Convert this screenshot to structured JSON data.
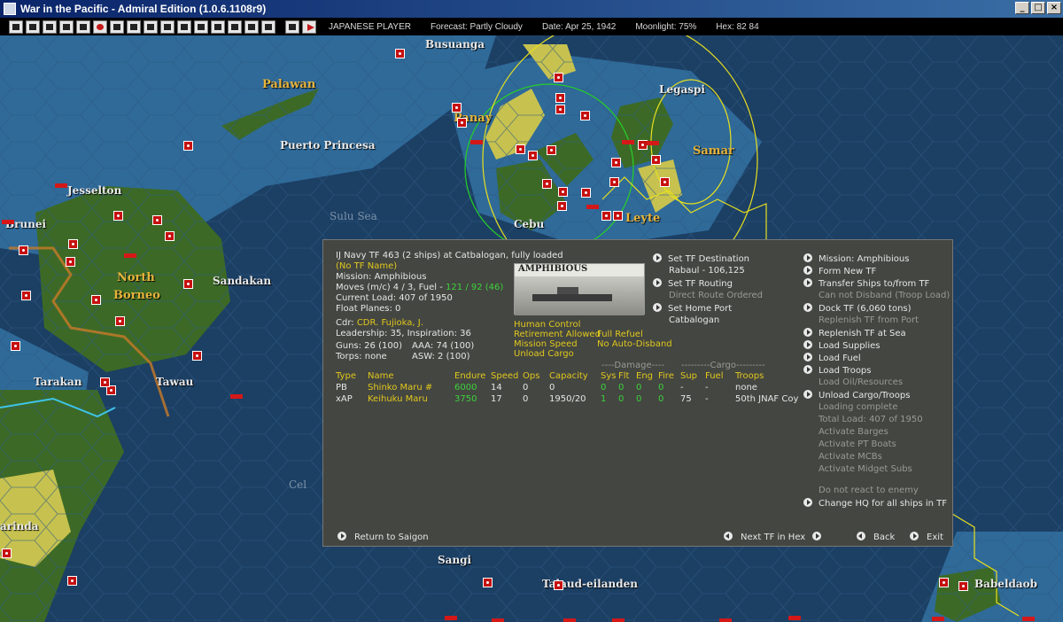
{
  "window": {
    "title": "War in the Pacific - Admiral Edition (1.0.6.1108r9)"
  },
  "toolbar": {
    "tool_icons": [
      "report-icon",
      "list-icon",
      "ships-icon",
      "aircraft-icon",
      "intel-icon",
      "rising-sun-icon",
      "squad-icon",
      "plane-icon",
      "flag-icon",
      "units-icon",
      "air-group-icon",
      "task-force-icon",
      "base-icon",
      "production-icon",
      "op-report-icon",
      "combat-report-icon",
      "save-icon",
      "end-turn-icon"
    ]
  },
  "status": {
    "player": "JAPANESE PLAYER",
    "forecast": "Forecast: Partly Cloudy",
    "date": "Date: Apr 25, 1942",
    "moonlight": "Moonlight: 75%",
    "hex": "Hex: 82 84"
  },
  "map": {
    "labels": [
      "Busuanga",
      "Palawan",
      "Panay",
      "Legaspi",
      "Samar",
      "Puerto Princesa",
      "Jesselton",
      "Brunei",
      "Sulu Sea",
      "Cebu",
      "Leyte",
      "North",
      "Borneo",
      "Sandakan",
      "Tarakan",
      "Tawau",
      "Sangi",
      "Talaud-eilanden",
      "Babeldaob",
      "arinda",
      "Cel"
    ]
  },
  "tf": {
    "header": "IJ Navy TF 463 (2 ships) at Catbalogan, fully loaded",
    "name": "(No TF Name)",
    "mission": "Mission: Amphibious",
    "moves_prefix": "Moves (m/c) 4 / 3, Fuel - ",
    "moves_fuel": "121 / 92 (46)",
    "load": "Current Load:  407 of 1950",
    "float": "Float Planes: 0",
    "cdr_label": "Cdr:",
    "cdr": "CDR. Fujioka, J.",
    "leadership": "Leadership: 35, Inspiration: 36",
    "guns": "Guns: 26 (100)",
    "aaa": "AAA: 74 (100)",
    "torps": "Torps: none",
    "asw": "ASW: 2 (100)",
    "photo_label": "AMPHIBIOUS",
    "flags_left": [
      "Human Control",
      "Retirement Allowed",
      "Mission Speed",
      "Unload Cargo"
    ],
    "flags_right": [
      "Full Refuel",
      "No Auto-Disband"
    ]
  },
  "table": {
    "headers": {
      "type": "Type",
      "name": "Name",
      "endure": "Endure",
      "speed": "Speed",
      "ops": "Ops",
      "capacity": "Capacity",
      "damage_group": "----Damage----",
      "sys": "Sys",
      "flt": "Flt",
      "eng": "Eng",
      "fire": "Fire",
      "cargo_group": "---------Cargo---------",
      "sup": "Sup",
      "fuel": "Fuel",
      "troops": "Troops"
    },
    "rows": [
      {
        "type": "PB",
        "name": "Shinko Maru #",
        "endure": "6000",
        "speed": "14",
        "ops": "0",
        "capacity": "0",
        "sys": "0",
        "flt": "0",
        "eng": "0",
        "fire": "0",
        "sup": "-",
        "fuel": "-",
        "troops": "none"
      },
      {
        "type": "xAP",
        "name": "Keihuku Maru",
        "endure": "3750",
        "speed": "17",
        "ops": "0",
        "capacity": "1950/20",
        "sys": "1",
        "flt": "0",
        "eng": "0",
        "fire": "0",
        "sup": "75",
        "fuel": "-",
        "troops": "50th JNAF Coy"
      }
    ]
  },
  "nav": {
    "set_dest": "Set TF Destination",
    "dest": "Rabaul - 106,125",
    "set_routing": "Set TF Routing",
    "routing": "Direct Route Ordered",
    "set_home": "Set Home Port",
    "home": "Catbalogan"
  },
  "actions": [
    {
      "label": "Mission: Amphibious",
      "active": true
    },
    {
      "label": "Form New TF",
      "active": true
    },
    {
      "label": "Transfer Ships to/from TF",
      "active": true
    },
    {
      "label": "Can not Disband (Troop Load)",
      "active": false
    },
    {
      "label": "Dock TF (6,060 tons)",
      "active": true
    },
    {
      "label": "Replenish TF from Port",
      "active": false
    },
    {
      "label": "Replenish TF at Sea",
      "active": true
    },
    {
      "label": "Load Supplies",
      "active": true
    },
    {
      "label": "Load Fuel",
      "active": true
    },
    {
      "label": "Load Troops",
      "active": true
    },
    {
      "label": "Load Oil/Resources",
      "active": false
    },
    {
      "label": "Unload Cargo/Troops",
      "active": true
    },
    {
      "label": "Loading complete",
      "active": false
    },
    {
      "label": "Total Load: 407 of 1950",
      "active": false
    },
    {
      "label": "Activate Barges",
      "active": false
    },
    {
      "label": "Activate PT Boats",
      "active": false
    },
    {
      "label": "Activate MCBs",
      "active": false
    },
    {
      "label": "Activate Midget Subs",
      "active": false
    }
  ],
  "actions_bottom": [
    {
      "label": "Do not react to enemy",
      "active": false
    },
    {
      "label": "Change HQ for all ships in TF",
      "active": true
    }
  ],
  "footer": {
    "return": "Return to Saigon",
    "next": "Next TF in Hex",
    "back": "Back",
    "exit": "Exit"
  },
  "colors": {
    "sea": "#1c3f64",
    "shallow": "#3d7aa8",
    "land": "#3c6a26",
    "land_yellow": "#c7c24f",
    "panel": "#444641",
    "highlight": "#e0c81e",
    "green_text": "#3cd23c",
    "base_marker": "#c61010"
  }
}
